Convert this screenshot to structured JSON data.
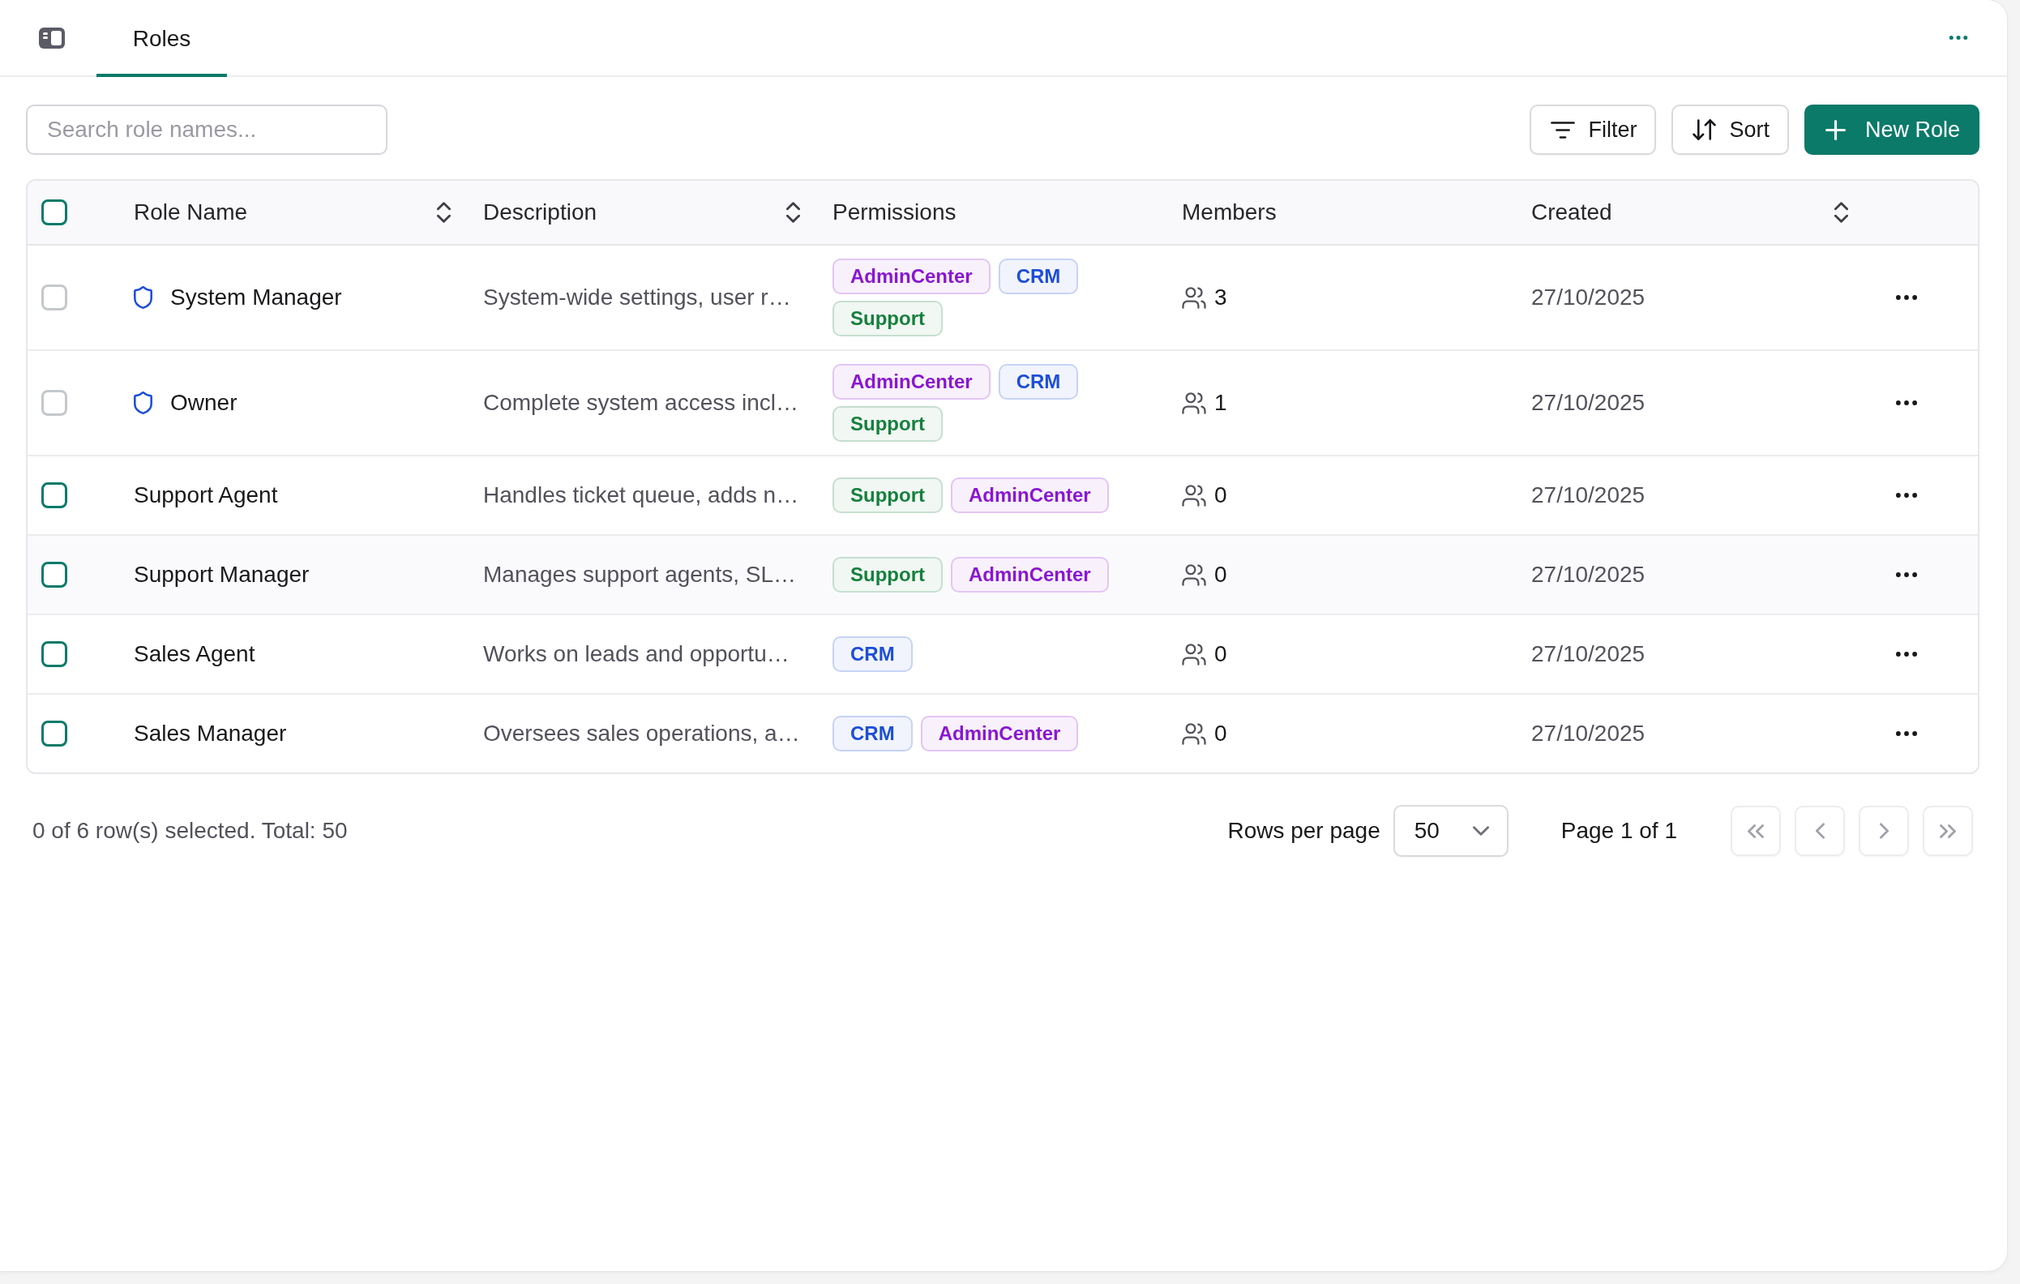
{
  "tabs": [
    {
      "label": "Roles",
      "selected": true
    }
  ],
  "search": {
    "placeholder": "Search role names..."
  },
  "toolbar_buttons": [
    {
      "kind": "filter",
      "label": "Filter"
    },
    {
      "kind": "sort",
      "label": "Sort"
    },
    {
      "kind": "create",
      "label": "New Role"
    }
  ],
  "table": {
    "select_all": {
      "checked": false
    },
    "columns": [
      {
        "label": "Role Name",
        "sortable": true
      },
      {
        "label": "Description",
        "sortable": true
      },
      {
        "label": "Permissions",
        "sortable": false
      },
      {
        "label": "Members",
        "sortable": false
      },
      {
        "label": "Created",
        "sortable": true
      }
    ],
    "rows": [
      {
        "name": "System Manager",
        "protected": true,
        "checked": false,
        "disabled": true,
        "highlighted": false,
        "description": "System-wide settings, user r…",
        "permissions": [
          {
            "label": "AdminCenter",
            "color": "#8a16d1"
          },
          {
            "label": "CRM",
            "color": "#1d4ed8"
          },
          {
            "label": "Support",
            "color": "#15803d"
          }
        ],
        "members": "3",
        "created": "27/10/2025"
      },
      {
        "name": "Owner",
        "protected": true,
        "checked": false,
        "disabled": true,
        "highlighted": false,
        "description": "Complete system access incl…",
        "permissions": [
          {
            "label": "AdminCenter",
            "color": "#8a16d1"
          },
          {
            "label": "CRM",
            "color": "#1d4ed8"
          },
          {
            "label": "Support",
            "color": "#15803d"
          }
        ],
        "members": "1",
        "created": "27/10/2025"
      },
      {
        "name": "Support Agent",
        "protected": false,
        "checked": false,
        "disabled": false,
        "highlighted": false,
        "description": "Handles ticket queue, adds n…",
        "permissions": [
          {
            "label": "Support",
            "color": "#15803d"
          },
          {
            "label": "AdminCenter",
            "color": "#8a16d1"
          }
        ],
        "members": "0",
        "created": "27/10/2025"
      },
      {
        "name": "Support Manager",
        "protected": false,
        "checked": false,
        "disabled": false,
        "highlighted": true,
        "description": "Manages support agents, SL…",
        "permissions": [
          {
            "label": "Support",
            "color": "#15803d"
          },
          {
            "label": "AdminCenter",
            "color": "#8a16d1"
          }
        ],
        "members": "0",
        "created": "27/10/2025"
      },
      {
        "name": "Sales Agent",
        "protected": false,
        "checked": false,
        "disabled": false,
        "highlighted": false,
        "description": "Works on leads and opportu…",
        "permissions": [
          {
            "label": "CRM",
            "color": "#1d4ed8"
          }
        ],
        "members": "0",
        "created": "27/10/2025"
      },
      {
        "name": "Sales Manager",
        "protected": false,
        "checked": false,
        "disabled": false,
        "highlighted": false,
        "description": "Oversees sales operations, a…",
        "permissions": [
          {
            "label": "CRM",
            "color": "#1d4ed8"
          },
          {
            "label": "AdminCenter",
            "color": "#8a16d1"
          }
        ],
        "members": "0",
        "created": "27/10/2025"
      }
    ]
  },
  "footer": {
    "selection": "0 of 6 row(s) selected. Total: 50",
    "rows_per_page_label": "Rows per page",
    "rows_per_page": "50",
    "page": "Page 1 of 1",
    "pager_buttons": [
      {
        "kind": "first",
        "disabled": true
      },
      {
        "kind": "previous",
        "disabled": true
      },
      {
        "kind": "next",
        "disabled": true
      },
      {
        "kind": "last",
        "disabled": true
      }
    ]
  }
}
